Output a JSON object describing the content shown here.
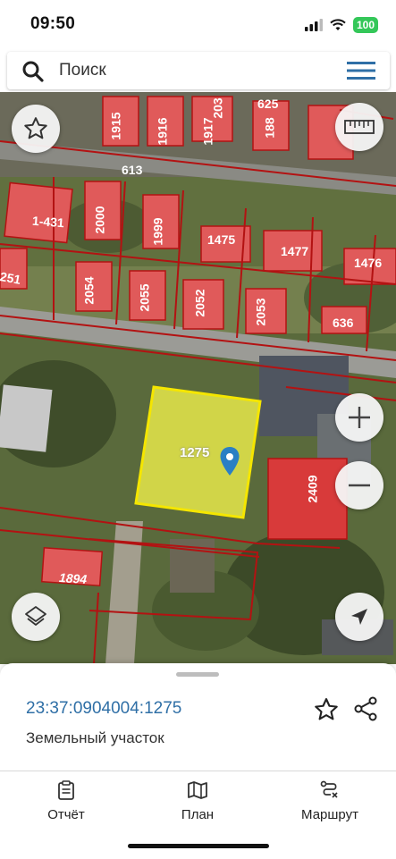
{
  "status": {
    "time": "09:50",
    "battery": "100"
  },
  "search": {
    "placeholder": "Поиск"
  },
  "map": {
    "parcel_labels": [
      "1915",
      "1916",
      "1917",
      "203",
      "625",
      "188",
      "613",
      "1-431",
      "2000",
      "1999",
      "1475",
      "1477",
      "1476",
      "251",
      "2054",
      "2055",
      "2052",
      "2053",
      "636",
      "1275",
      "2409",
      "1894"
    ],
    "selected_parcel": "1275",
    "colors": {
      "parcel_fill": "#e05a5a",
      "selected_fill": "#e8e84a",
      "selected_border": "#f5e600",
      "boundary": "#b31212",
      "pin": "#2a7fc4"
    }
  },
  "sheet": {
    "cadastral_number": "23:37:0904004:1275",
    "property_type": "Земельный участок"
  },
  "tabs": [
    {
      "label": "Отчёт",
      "icon": "report-icon"
    },
    {
      "label": "План",
      "icon": "map-plan-icon"
    },
    {
      "label": "Маршрут",
      "icon": "route-icon"
    }
  ]
}
